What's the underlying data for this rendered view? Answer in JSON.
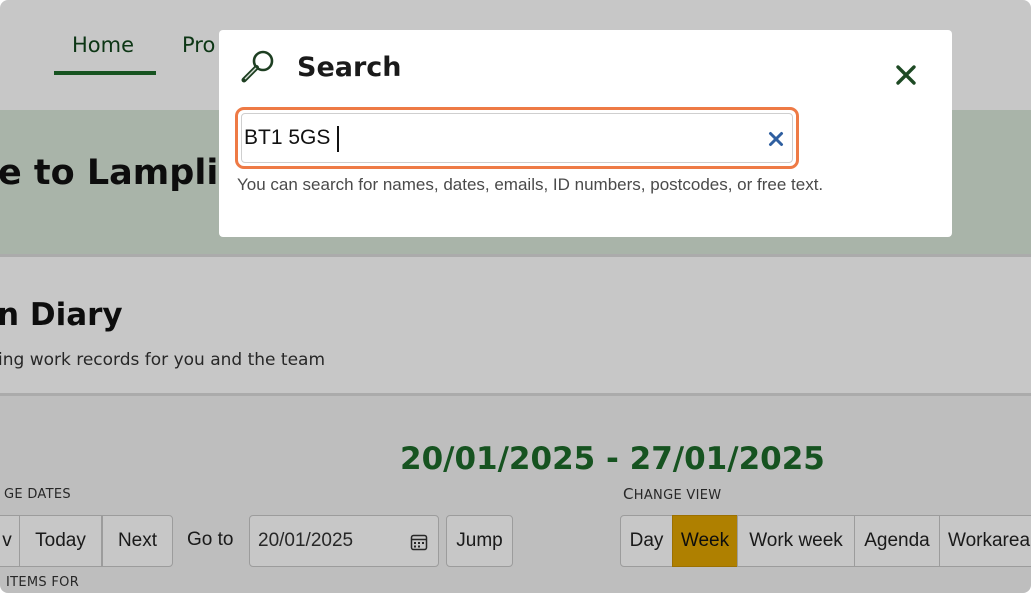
{
  "nav": {
    "tabs": [
      {
        "label": "Home",
        "active": true
      },
      {
        "label": "Pro",
        "active": false
      }
    ]
  },
  "hero": {
    "title": "e to Lamplig"
  },
  "diary": {
    "title": "n Diary",
    "subtitle": "ing work records for you and the team"
  },
  "calendar": {
    "date_range": "20/01/2025 - 27/01/2025",
    "change_dates_label": "GE DATES",
    "change_view_label": "CHANGE VIEW",
    "items_for_label": "ITEMS FOR",
    "prev_label": "v",
    "today_label": "Today",
    "next_label": "Next",
    "goto_label": "Go to",
    "goto_value": "20/01/2025",
    "jump_label": "Jump",
    "views": [
      {
        "label": "Day",
        "selected": false
      },
      {
        "label": "Week",
        "selected": true
      },
      {
        "label": "Work week",
        "selected": false
      },
      {
        "label": "Agenda",
        "selected": false
      },
      {
        "label": "Workarea",
        "selected": false
      }
    ]
  },
  "search_modal": {
    "title": "Search",
    "query": "BT1 5GS",
    "hint": "You can search for names, dates, emails, ID numbers, postcodes, or free text."
  },
  "colors": {
    "brand_green": "#1d6b2a",
    "selected_view": "#e0a500",
    "focus_ring": "#ee7a45",
    "clear_icon": "#2f5fa0"
  },
  "icons": [
    "magnifier-icon",
    "close-icon",
    "clear-icon",
    "calendar-icon"
  ]
}
